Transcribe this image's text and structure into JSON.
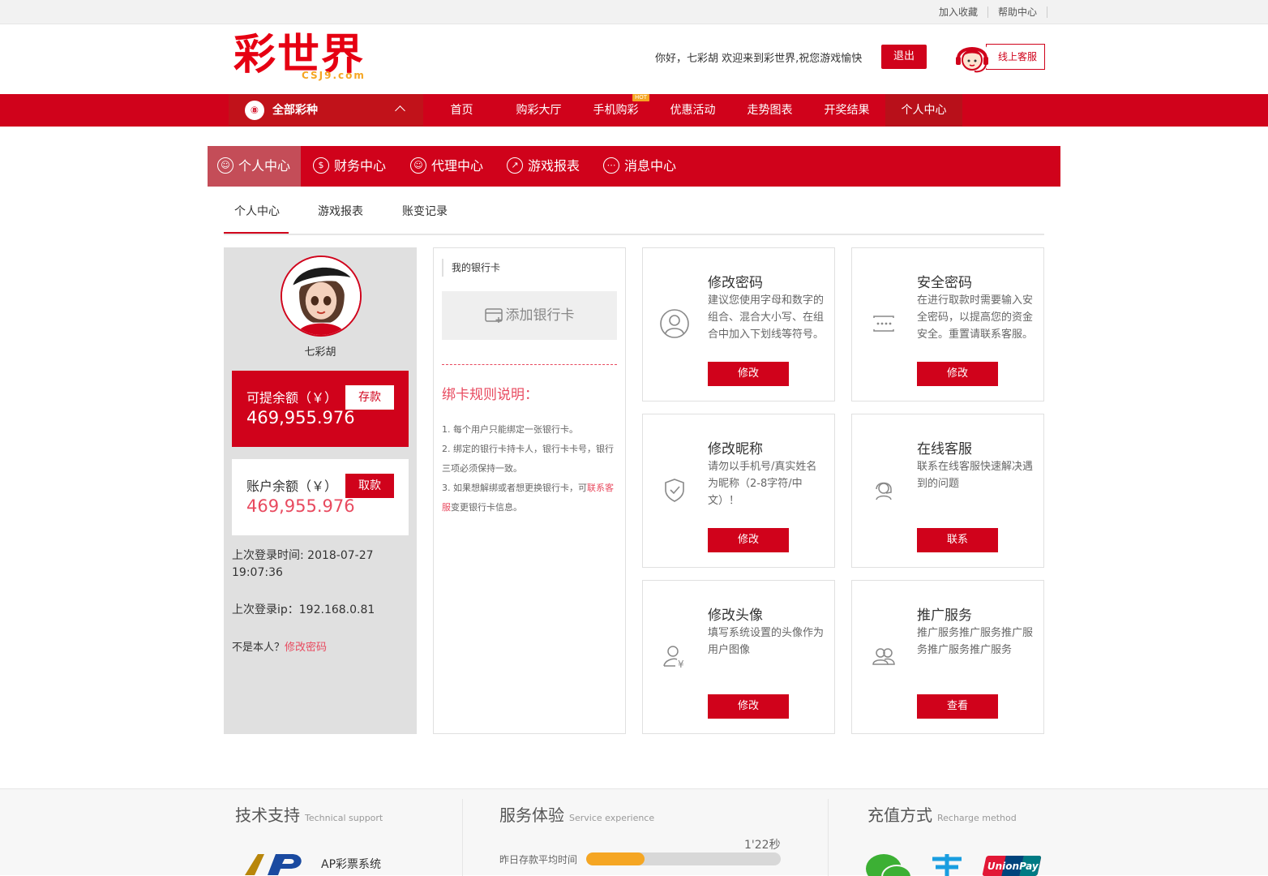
{
  "topbar": {
    "bookmark": "加入收藏",
    "help": "帮助中心"
  },
  "header": {
    "logo_text": "彩世界",
    "logo_sub": "CSJ9.com",
    "welcome": "你好，七彩胡 欢迎来到彩世界,祝您游戏愉快",
    "logout": "退出",
    "online_service": "线上客服"
  },
  "nav": {
    "all_icon": "⑧",
    "all_label": "全部彩种",
    "items": [
      "首页",
      "购彩大厅",
      "手机购彩",
      "优惠活动",
      "走势图表",
      "开奖结果",
      "个人中心"
    ],
    "hot_badge": "HOT"
  },
  "subnav": {
    "items": [
      "个人中心",
      "财务中心",
      "代理中心",
      "游戏报表",
      "消息中心"
    ],
    "icons": [
      "user-circle-icon",
      "dollar-icon",
      "agent-icon",
      "trend-icon",
      "message-icon"
    ]
  },
  "tabs": [
    "个人中心",
    "游戏报表",
    "账变记录"
  ],
  "profile": {
    "username": "七彩胡",
    "withdrawable_label": "可提余额（￥）",
    "withdrawable_value": "469,955.976",
    "deposit_button": "存款",
    "account_label": "账户余额（￥）",
    "account_value": "469,955.976",
    "withdraw_button": "取款",
    "last_login": "上次登录时间: 2018-07-27 19:07:36",
    "last_ip": "上次登录ip：192.168.0.81",
    "not_me": "不是本人？",
    "change_password_link": "修改密码"
  },
  "bank": {
    "header": "我的银行卡",
    "add_button": "添加银行卡",
    "rules_title": "绑卡规则说明：",
    "rule1": "1. 每个用户只能绑定一张银行卡。",
    "rule2": "2. 绑定的银行卡持卡人，银行卡卡号，银行三项必须保持一致。",
    "rule3_pre": "3. 如果想解绑或者想更换银行卡，可",
    "rule3_link": "联系客服",
    "rule3_post": "变更银行卡信息。"
  },
  "features": [
    {
      "title": "修改密码",
      "desc": "建议您使用字母和数字的组合、混合大小写、在组合中加入下划线等符号。",
      "button": "修改",
      "icon": "user-icon"
    },
    {
      "title": "安全密码",
      "desc": "在进行取款时需要输入安全密码，以提高您的资金安全。重置请联系客服。",
      "button": "修改",
      "icon": "password-icon"
    },
    {
      "title": "修改昵称",
      "desc": "请勿以手机号/真实姓名为昵称（2-8字符/中文）！",
      "button": "修改",
      "icon": "shield-icon"
    },
    {
      "title": "在线客服",
      "desc": "联系在线客服快速解决遇到的问题",
      "button": "联系",
      "icon": "headset-icon"
    },
    {
      "title": "修改头像",
      "desc": "填写系统设置的头像作为用户图像",
      "button": "修改",
      "icon": "user-yen-icon"
    },
    {
      "title": "推广服务",
      "desc": "推广服务推广服务推广服务推广服务推广服务",
      "button": "查看",
      "icon": "users-icon"
    }
  ],
  "footer": {
    "tech_title": "技术支持",
    "tech_sub": "Technical support",
    "ap_label": "AP彩票系统",
    "service_title": "服务体验",
    "service_sub": "Service experience",
    "deposit_time_label": "昨日存款平均时间",
    "deposit_time_value": "1'22秒",
    "deposit_bar_fraction": 0.3,
    "recharge_title": "充值方式",
    "recharge_sub": "Recharge method",
    "unionpay": "UnionPay"
  },
  "colors": {
    "brand": "#d0021b",
    "accent": "#f5a623",
    "highlight": "#e84a5f"
  }
}
